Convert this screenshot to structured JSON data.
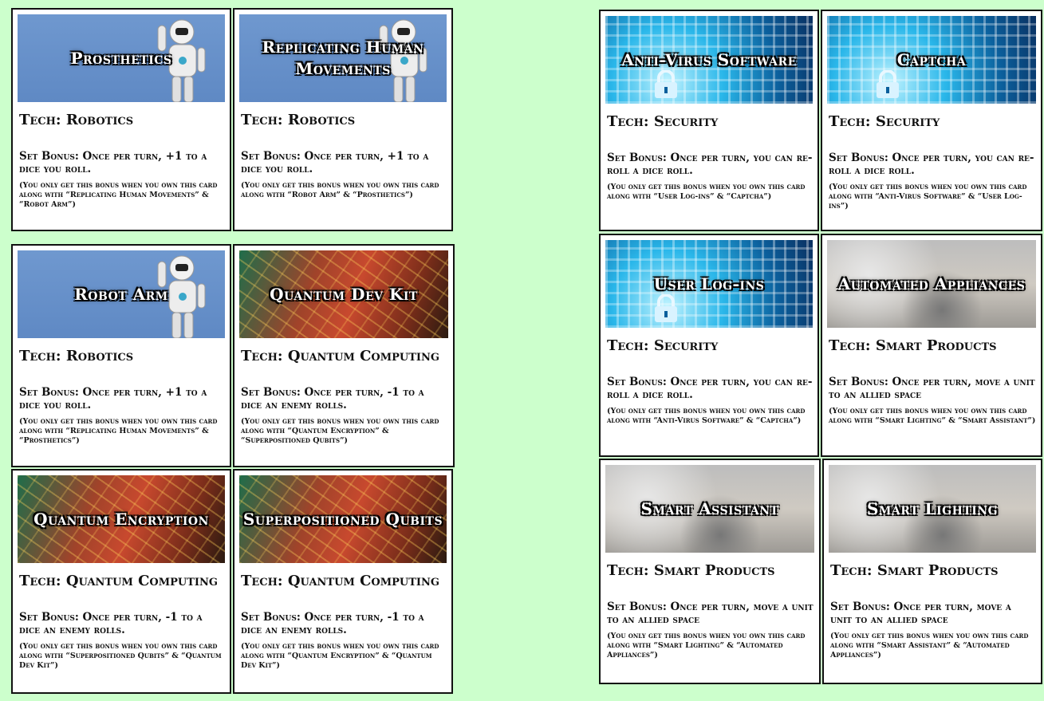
{
  "cards": [
    {
      "title": "Prosthetics",
      "tech": "Tech: Robotics",
      "bonus": "Set Bonus: Once per turn, +1 to a dice you roll.",
      "note": "(You only get this bonus when you own this card along with “Replicating Human Movements” & “Robot Arm”)",
      "art": "robot-image"
    },
    {
      "title": "Replicating Human Movements",
      "tech": "Tech: Robotics",
      "bonus": "Set Bonus: Once per turn, +1 to a dice you roll.",
      "note": "(You only get this bonus when you own this card along with “Robot Arm” & “Prosthetics”)",
      "art": "robot-image"
    },
    {
      "title": "Robot Arm",
      "tech": "Tech: Robotics",
      "bonus": "Set Bonus: Once per turn, +1 to a dice you roll.",
      "note": "(You only get this bonus when you own this card along with “Replicating Human Movements” & “Prosthetics”)",
      "art": "robot-image"
    },
    {
      "title": "Quantum Dev Kit",
      "tech": "Tech: Quantum Computing",
      "bonus": "Set Bonus: Once per turn, -1 to a dice an enemy rolls.",
      "note": "(You only get this bonus when you own this card along with “Quantum Encryption” & “Superpositioned Qubits”)",
      "art": "circuit-image"
    },
    {
      "title": "Quantum Encryption",
      "tech": "Tech: Quantum Computing",
      "bonus": "Set Bonus: Once per turn, -1 to a dice an enemy rolls.",
      "note": "(You only get this bonus when you own this card along with “Superpositioned Qubits” & “Quantum Dev Kit”)",
      "art": "circuit-image"
    },
    {
      "title": "Superpositioned Qubits",
      "tech": "Tech: Quantum Computing",
      "bonus": "Set Bonus: Once per turn, -1 to a dice an enemy rolls.",
      "note": "(You only get this bonus when you own this card along with “Quantum Encryption” & “Quantum Dev Kit”)",
      "art": "circuit-image"
    },
    {
      "title": "Anti-Virus Software",
      "tech": "Tech: Security",
      "bonus": "Set Bonus: Once per turn, you can re-roll a dice roll.",
      "note": "(You only get this bonus when you own this card along with “User Log-ins” & “Captcha”)",
      "art": "lock-image"
    },
    {
      "title": "Captcha",
      "tech": "Tech: Security",
      "bonus": "Set Bonus: Once per turn, you can re-roll a dice roll.",
      "note": "(You only get this bonus when you own this card along with “Anti-Virus Software” & “User Log-ins”)",
      "art": "lock-image"
    },
    {
      "title": "User Log-ins",
      "tech": "Tech: Security",
      "bonus": "Set Bonus: Once per turn, you can re-roll a dice roll.",
      "note": "(You only get this bonus when you own this card along with “Anti-Virus Software” & “Captcha”)",
      "art": "lock-image"
    },
    {
      "title": "Automated Appliances",
      "tech": "Tech: Smart Products",
      "bonus": "Set Bonus: Once per turn, move a unit to an allied space",
      "note": "(You only get this bonus when you own this card along with “Smart Lighting” & “Smart Assistant”)",
      "art": "room-image"
    },
    {
      "title": "Smart Assistant",
      "tech": "Tech: Smart Products",
      "bonus": "Set Bonus: Once per turn, move a unit to an allied space",
      "note": "(You only get this bonus when you own this card along with “Smart Lighting” & “Automated Appliances”)",
      "art": "room-image"
    },
    {
      "title": "Smart Lighting",
      "tech": "Tech: Smart Products",
      "bonus": "Set Bonus: Once per turn, move a unit to an allied space",
      "note": "(You only get this bonus when you own this card along with “Smart Assistant” & “Automated Appliances”)",
      "art": "room-image"
    }
  ],
  "colors": {
    "background": "#ccffcc",
    "card": "#ffffff",
    "border": "#111111"
  }
}
